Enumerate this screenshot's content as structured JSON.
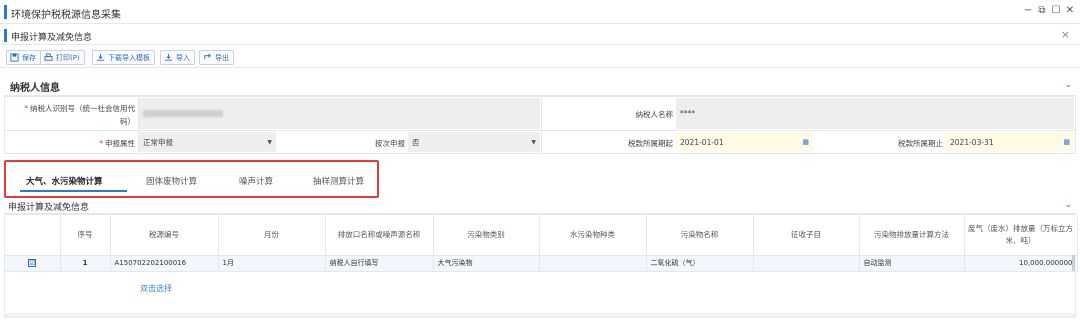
{
  "window": {
    "title": "环境保护税税源信息采集",
    "controls": [
      "−",
      "⧉",
      "☐",
      "✕"
    ]
  },
  "subwindow": {
    "title": "申报计算及减免信息",
    "close": "×"
  },
  "toolbar": {
    "save": "保存",
    "print": "打印(P)",
    "download_template": "下载导入模板",
    "import": "导入",
    "export": "导出"
  },
  "taxpayer_section": {
    "title": "纳税人信息",
    "fields": {
      "id_label": "纳税人识别号（统一社会信用代码）",
      "id_label_l1": "纳税人识别号（统一社会信用代",
      "id_label_l2": "码）",
      "id_value": "",
      "name_label": "纳税人名称",
      "name_value": "****",
      "attr_label": "申报属性",
      "attr_value": "正常申报",
      "by_time_label": "按次申报",
      "by_time_value": "否",
      "period_start_label": "税款所属期起",
      "period_start_value": "2021-01-01",
      "period_end_label": "税款所属期止",
      "period_end_value": "2021-03-31"
    }
  },
  "tabs": [
    {
      "label": "大气、水污染物计算",
      "active": true
    },
    {
      "label": "固体废物计算",
      "active": false
    },
    {
      "label": "噪声计算",
      "active": false
    },
    {
      "label": "抽样测算计算",
      "active": false
    }
  ],
  "calc_section": {
    "title": "申报计算及减免信息",
    "columns": [
      "",
      "序号",
      "税源编号",
      "月份",
      "排放口名称或噪声源名称",
      "污染物类别",
      "水污染物种类",
      "污染物名称",
      "征收子目",
      "污染物排放量计算方法",
      "废气（废水）排放量（万标立方米、吨）"
    ],
    "rows": [
      {
        "checked": "☑",
        "index": "1",
        "source_no": "A150702202100016",
        "month": "1月",
        "outlet": "纳税人自行填写",
        "category": "大气污染物",
        "water_kind": "",
        "pollutant": "二氧化硫（气）",
        "sub_item": "",
        "method": "自动监测",
        "volume": "10,000.000000"
      }
    ],
    "pick_hint": "双击选择"
  },
  "colors": {
    "accent": "#2a7ad8",
    "required": "#e03d3d",
    "highlight_border": "#e23b3b"
  }
}
